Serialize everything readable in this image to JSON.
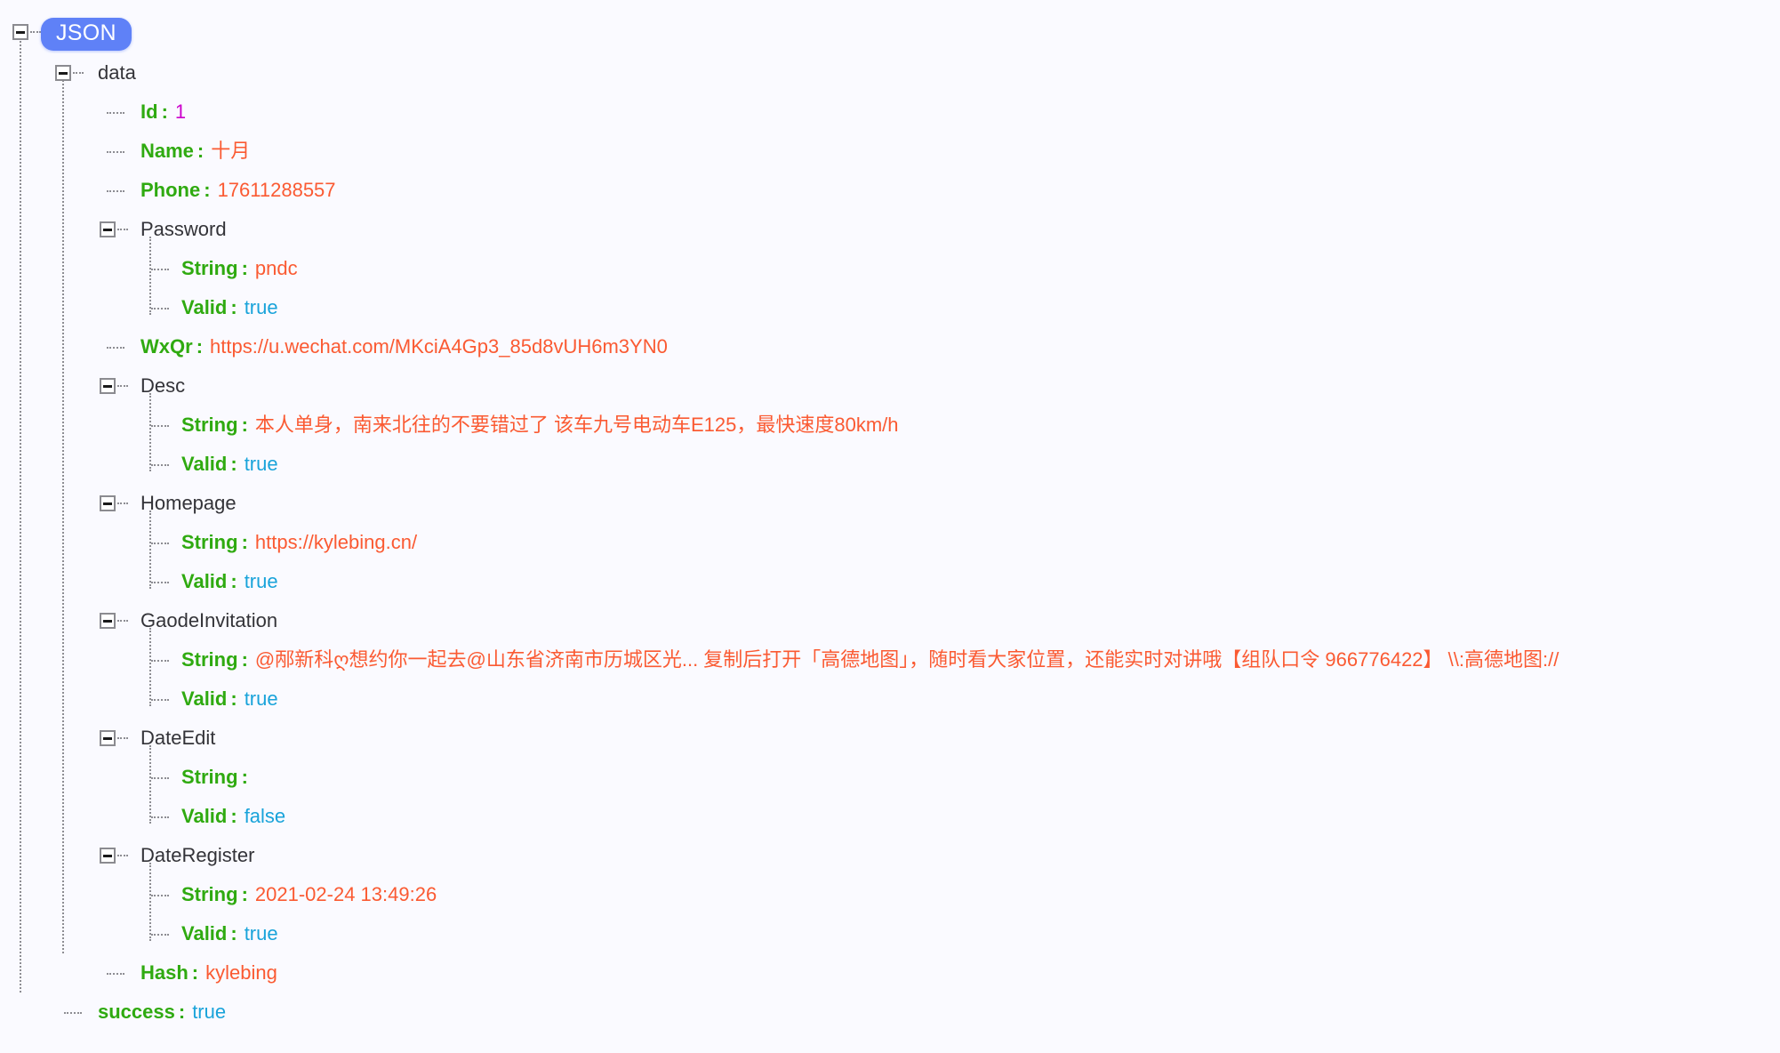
{
  "viewer": {
    "root_badge_label": "JSON",
    "background_color": "#fafaff",
    "key_color": "#2faa10",
    "string_color": "#fa5a32",
    "number_color": "#cc00cc",
    "boolean_color": "#19a3da",
    "node_label_color": "#333338",
    "badge_color": "#5f81f7",
    "guide_color": "#8d8d93"
  },
  "nodes": {
    "data_label": "data",
    "id_key": "Id",
    "id_value": "1",
    "name_key": "Name",
    "name_value": "十月",
    "phone_key": "Phone",
    "phone_value": "17611288557",
    "password_label": "Password",
    "password_string_key": "String",
    "password_string_value": "pndc",
    "password_valid_key": "Valid",
    "password_valid_value": "true",
    "wxqr_key": "WxQr",
    "wxqr_value": "https://u.wechat.com/MKciA4Gp3_85d8vUH6m3YN0",
    "desc_label": "Desc",
    "desc_string_key": "String",
    "desc_string_value": "本人单身，南来北往的不要错过了 该车九号电动车E125，最快速度80km/h",
    "desc_valid_key": "Valid",
    "desc_valid_value": "true",
    "homepage_label": "Homepage",
    "homepage_string_key": "String",
    "homepage_string_value": "https://kylebing.cn/",
    "homepage_valid_key": "Valid",
    "homepage_valid_value": "true",
    "gaode_label": "GaodeInvitation",
    "gaode_string_key": "String",
    "gaode_string_value": "@邴新科ღ想约你一起去@山东省济南市历城区光... 复制后打开「高德地图」，随时看大家位置，还能实时对讲哦【组队口令 966776422】 \\\\:高德地图://",
    "gaode_valid_key": "Valid",
    "gaode_valid_value": "true",
    "dateedit_label": "DateEdit",
    "dateedit_string_key": "String",
    "dateedit_string_value": "",
    "dateedit_valid_key": "Valid",
    "dateedit_valid_value": "false",
    "dateregister_label": "DateRegister",
    "dateregister_string_key": "String",
    "dateregister_string_value": "2021-02-24 13:49:26",
    "dateregister_valid_key": "Valid",
    "dateregister_valid_value": "true",
    "hash_key": "Hash",
    "hash_value": "kylebing",
    "success_key": "success",
    "success_value": "true"
  }
}
